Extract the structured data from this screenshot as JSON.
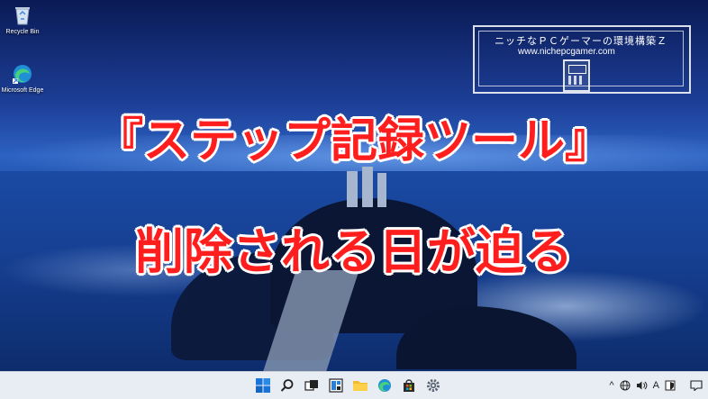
{
  "desktop": {
    "icons": [
      {
        "label": "Recycle Bin",
        "icon": "recycle-bin-icon"
      },
      {
        "label": "Microsoft Edge",
        "icon": "edge-icon"
      }
    ]
  },
  "watermark": {
    "title": "ニッチなＰＣゲーマーの環境構築Ｚ",
    "url": "www.nichepcgamer.com"
  },
  "headline": {
    "line1": "『ステップ記録ツール』",
    "line2": "削除される日が迫る"
  },
  "taskbar": {
    "center_icons": [
      "windows-start-icon",
      "search-icon",
      "task-view-icon",
      "widgets-icon",
      "file-explorer-icon",
      "edge-icon",
      "store-icon",
      "settings-icon"
    ],
    "tray": {
      "chevron": "^",
      "ime": "A"
    }
  },
  "colors": {
    "headline": "#ff1e1e",
    "headline_outline": "#ffffff",
    "taskbar_bg": "#e8ecf3"
  }
}
